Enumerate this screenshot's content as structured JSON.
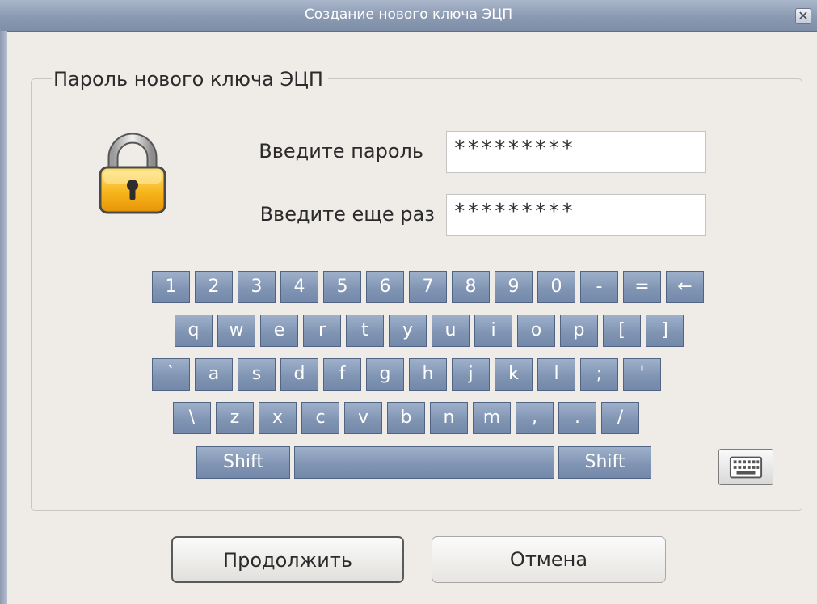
{
  "window": {
    "title": "Создание нового ключа ЭЦП",
    "close_glyph": "✕"
  },
  "group": {
    "legend": "Пароль нового ключа ЭЦП"
  },
  "form": {
    "password_label": "Введите пароль",
    "password_value": "*********",
    "confirm_label": "Введите еще раз",
    "confirm_value": "*********"
  },
  "keyboard": {
    "row1": [
      "1",
      "2",
      "3",
      "4",
      "5",
      "6",
      "7",
      "8",
      "9",
      "0",
      "-",
      "=",
      "←"
    ],
    "row2": [
      "q",
      "w",
      "e",
      "r",
      "t",
      "y",
      "u",
      "i",
      "o",
      "p",
      "[",
      "]"
    ],
    "row3": [
      "`",
      "a",
      "s",
      "d",
      "f",
      "g",
      "h",
      "j",
      "k",
      "l",
      ";",
      "'"
    ],
    "row4": [
      "\\",
      "z",
      "x",
      "c",
      "v",
      "b",
      "n",
      "m",
      ",",
      ".",
      "/"
    ],
    "shift_left": "Shift",
    "space": "",
    "shift_right": "Shift",
    "toggle_icon": "keyboard-icon"
  },
  "buttons": {
    "continue": "Продолжить",
    "cancel": "Отмена"
  },
  "colors": {
    "titlebar": "#8b9ab2",
    "key": "#7f93b2",
    "background": "#efece8"
  }
}
